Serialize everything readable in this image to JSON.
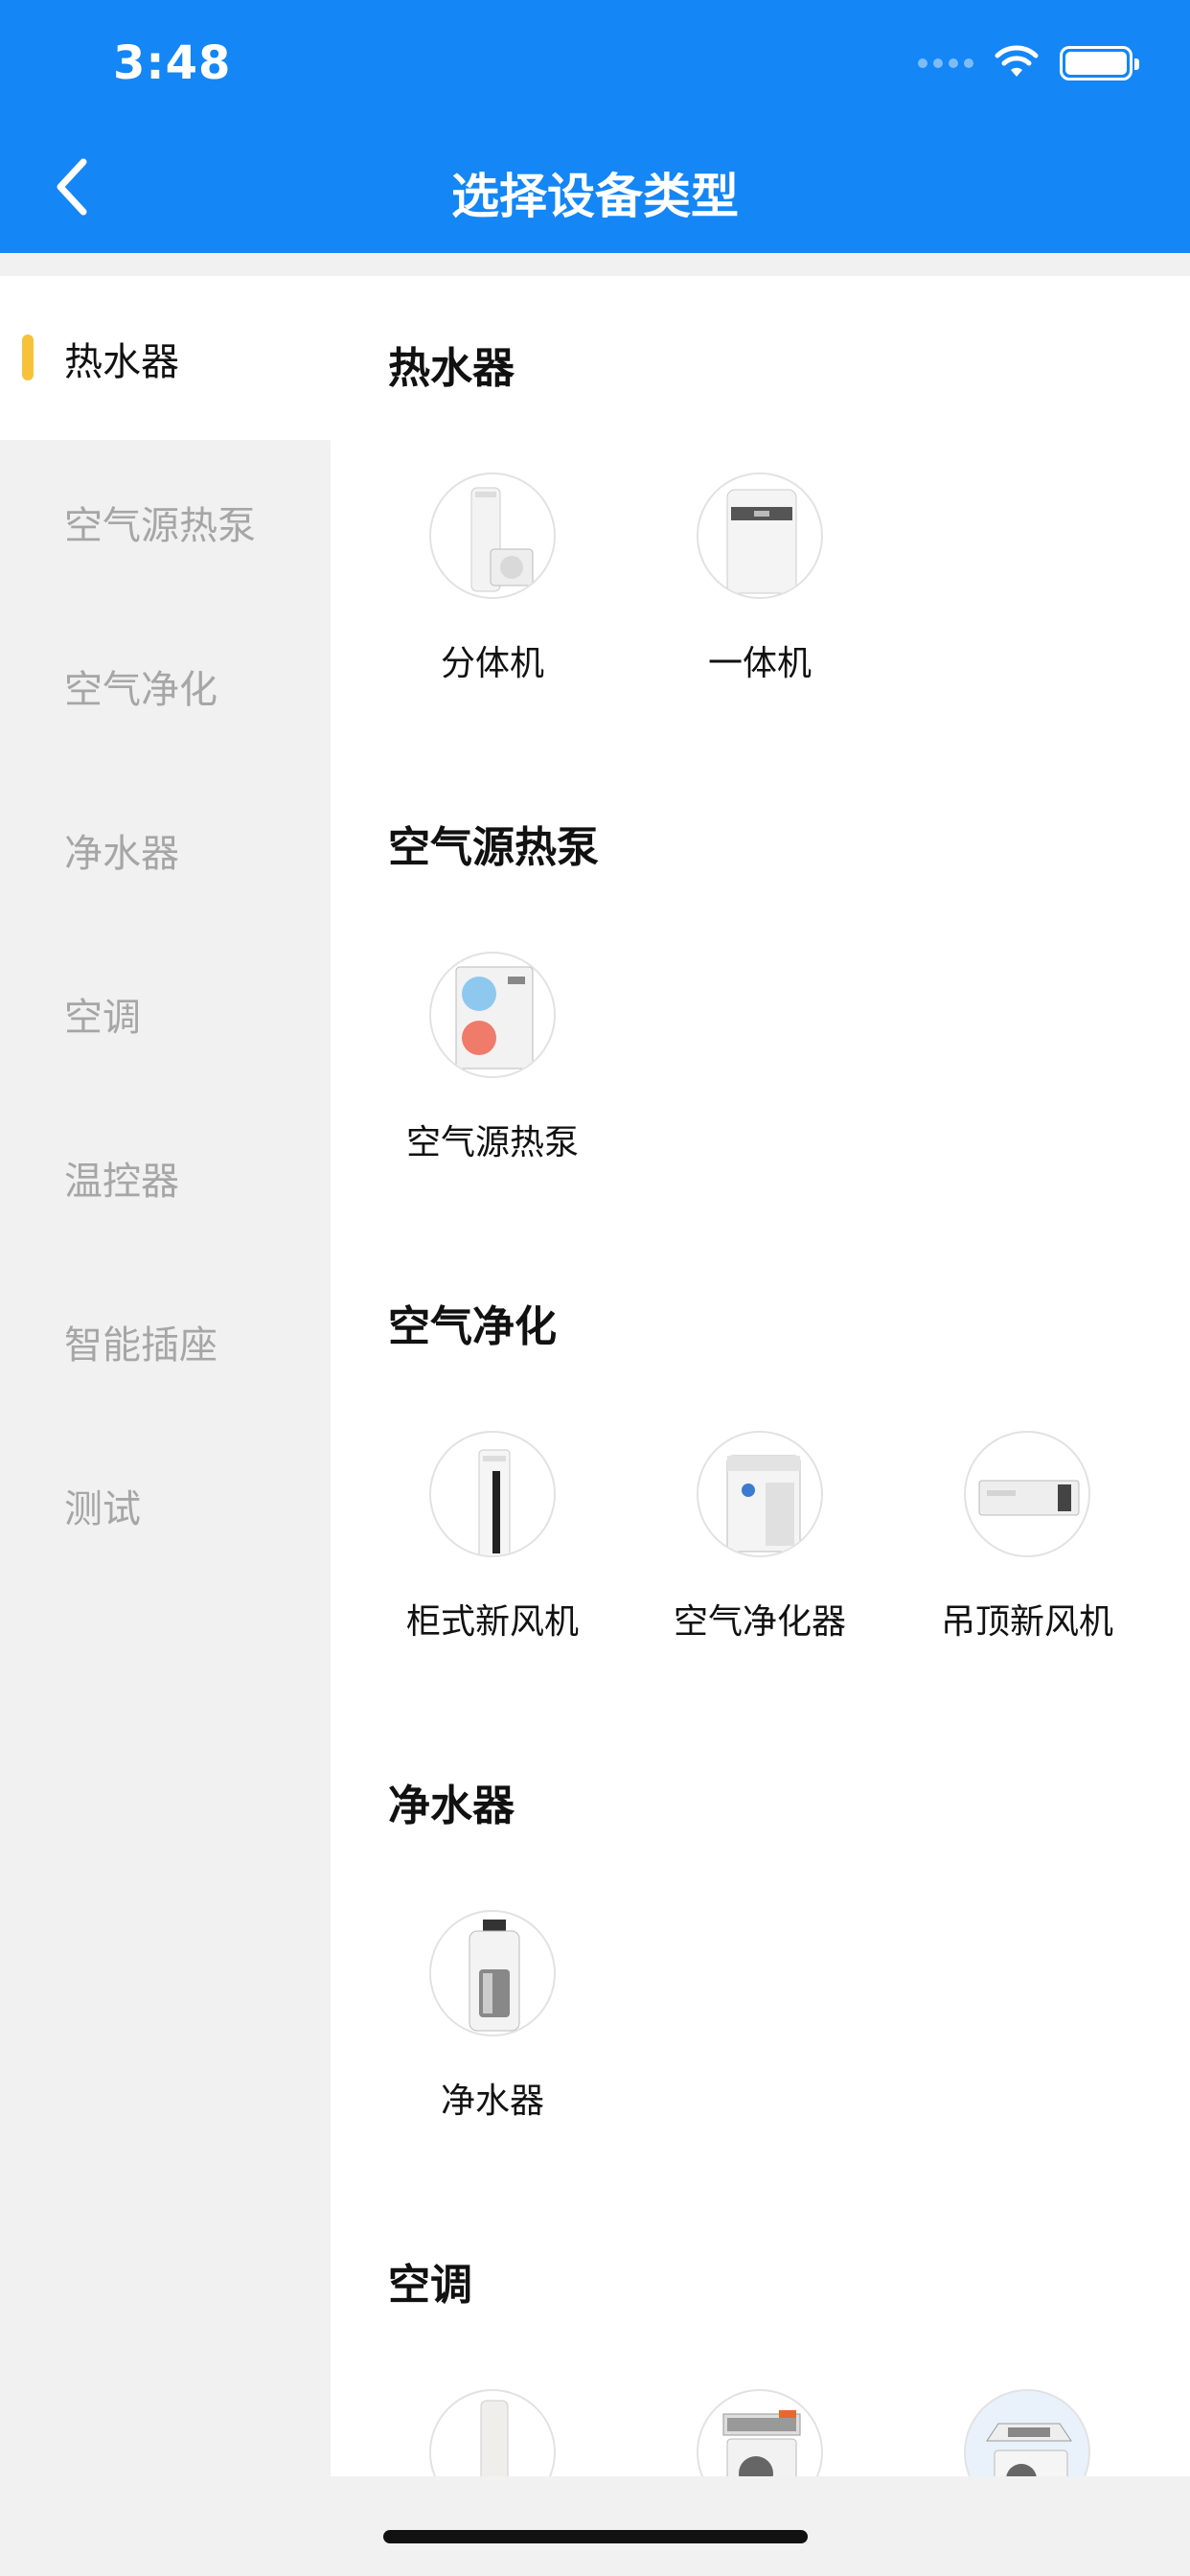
{
  "status_bar": {
    "time": "3:48"
  },
  "header": {
    "title": "选择设备类型"
  },
  "sidebar": {
    "items": [
      {
        "label": "热水器",
        "active": true
      },
      {
        "label": "空气源热泵",
        "active": false
      },
      {
        "label": "空气净化",
        "active": false
      },
      {
        "label": "净水器",
        "active": false
      },
      {
        "label": "空调",
        "active": false
      },
      {
        "label": "温控器",
        "active": false
      },
      {
        "label": "智能插座",
        "active": false
      },
      {
        "label": "测试",
        "active": false
      }
    ]
  },
  "sections": [
    {
      "title": "热水器",
      "devices": [
        {
          "label": "分体机"
        },
        {
          "label": "一体机"
        }
      ]
    },
    {
      "title": "空气源热泵",
      "devices": [
        {
          "label": "空气源热泵"
        }
      ]
    },
    {
      "title": "空气净化",
      "devices": [
        {
          "label": "柜式新风机"
        },
        {
          "label": "空气净化器"
        },
        {
          "label": "吊顶新风机"
        }
      ]
    },
    {
      "title": "净水器",
      "devices": [
        {
          "label": "净水器"
        }
      ]
    },
    {
      "title": "空调",
      "devices": [
        {
          "label": ""
        },
        {
          "label": ""
        },
        {
          "label": ""
        }
      ]
    }
  ],
  "colors": {
    "header": "#1486f5",
    "active_indicator": "#f7c23a"
  }
}
